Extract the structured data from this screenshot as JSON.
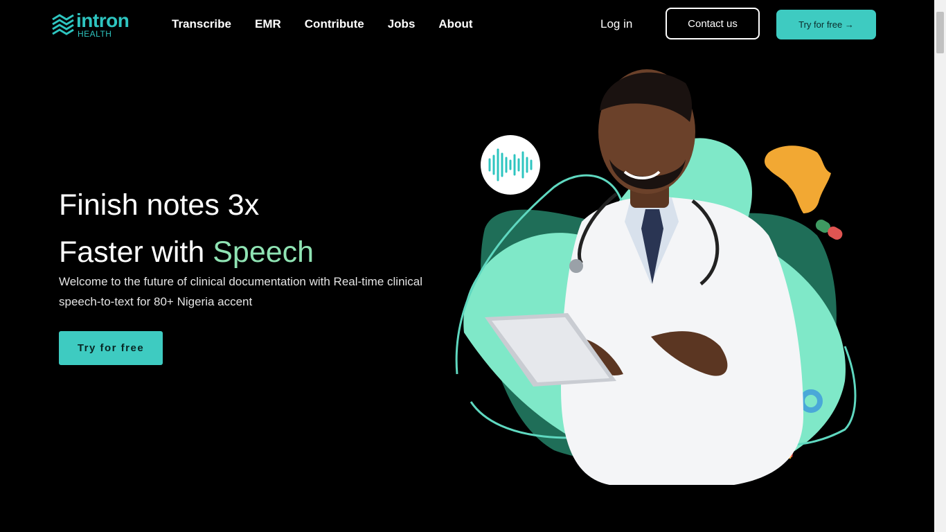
{
  "header": {
    "logo": {
      "word": "intron",
      "sub": "HEALTH"
    },
    "nav": [
      "Transcribe",
      "EMR",
      "Contribute",
      "Jobs",
      "About"
    ],
    "login": "Log in",
    "contact": "Contact us",
    "try_free": "Try for free →"
  },
  "hero": {
    "title_line1": "Finish notes 3x",
    "title_line2_prefix": "Faster with ",
    "title_line2_accent": "Speech",
    "subtitle": "Welcome to the future of clinical documentation with Real-time clinical speech-to-text for 80+ Nigeria accent",
    "cta": "Try for free"
  },
  "colors": {
    "brand": "#2ec5c0",
    "accent_green": "#8fe3b3",
    "dark_green": "#1f6e58",
    "mint": "#7fe8c8",
    "africa": "#f2a833"
  },
  "icons": [
    "logo-mark-icon",
    "audio-wave-icon",
    "africa-map-icon",
    "pill-icon",
    "drum-icon",
    "ring-icon"
  ]
}
